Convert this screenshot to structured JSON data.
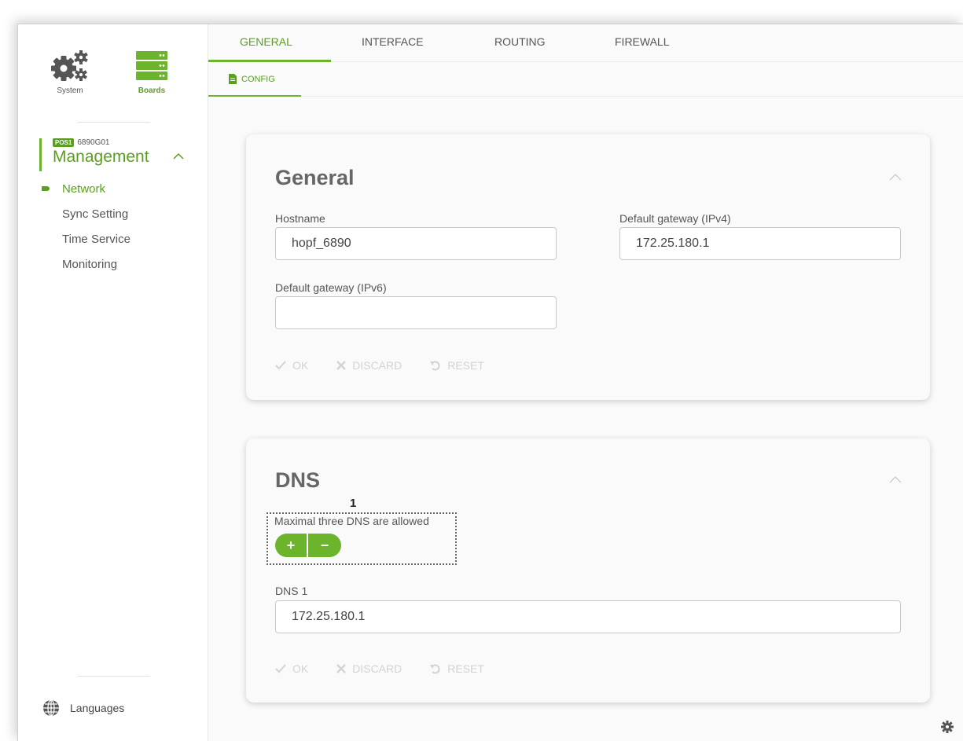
{
  "sidebar": {
    "system_label": "System",
    "boards_label": "Boards",
    "device_badge": "POS1",
    "device_id": "6890G01",
    "section_title": "Management",
    "items": [
      {
        "label": "Network"
      },
      {
        "label": "Sync Setting"
      },
      {
        "label": "Time Service"
      },
      {
        "label": "Monitoring"
      }
    ],
    "languages_label": "Languages"
  },
  "tabs": [
    {
      "label": "GENERAL"
    },
    {
      "label": "INTERFACE"
    },
    {
      "label": "ROUTING"
    },
    {
      "label": "FIREWALL"
    }
  ],
  "subtab": {
    "label": "CONFIG"
  },
  "general": {
    "title": "General",
    "hostname_label": "Hostname",
    "hostname_value": "hopf_6890",
    "gw4_label": "Default gateway (IPv4)",
    "gw4_value": "172.25.180.1",
    "gw6_label": "Default gateway (IPv6)",
    "gw6_value": "",
    "ok_label": "OK",
    "discard_label": "DISCARD",
    "reset_label": "RESET"
  },
  "dns": {
    "title": "DNS",
    "callout_number": "1",
    "note": "Maximal three DNS are allowed",
    "plus_label": "+",
    "minus_label": "−",
    "dns1_label": "DNS 1",
    "dns1_value": "172.25.180.1",
    "ok_label": "OK",
    "discard_label": "DISCARD",
    "reset_label": "RESET"
  },
  "colors": {
    "accent": "#6cb42c",
    "accent_dark": "#5aa01e",
    "disabled": "#d3d3d3"
  }
}
